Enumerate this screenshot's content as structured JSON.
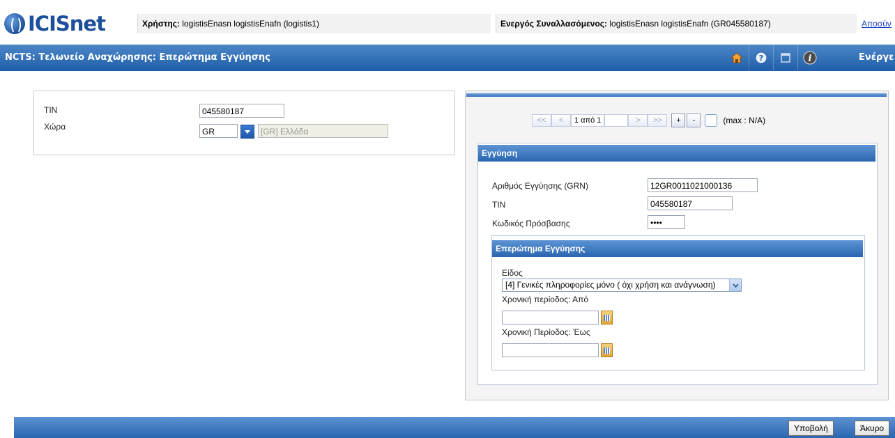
{
  "header": {
    "logo_text": "ICISnet",
    "user_label": "Χρήστης:",
    "user_value": "logistisEnasn logistisEnafn (logistis1)",
    "active_trader_label": "Ενεργός Συναλλασόμενος:",
    "active_trader_value": "logistisEnasn logistisEnafn (GR045580187)",
    "logout_link": "Αποσύν"
  },
  "titlebar": {
    "title": "NCTS: Τελωνείο Αναχώρησης: Επερώτημα Εγγύησης",
    "icons": [
      "home-icon",
      "help-icon",
      "window-icon",
      "info-icon"
    ],
    "active_label": "Ενέργε"
  },
  "left_form": {
    "tin_label": "TIN",
    "tin_value": "045580187",
    "country_label": "Χώρα",
    "country_code": "GR",
    "country_name": "[GR] Ελλάδα"
  },
  "pager": {
    "first": "<<",
    "prev": "<",
    "count": "1 από 1",
    "next": ">",
    "last": ">>",
    "add": "+",
    "remove": "-",
    "max": "(max : N/A)"
  },
  "guarantee": {
    "header": "Εγγύηση",
    "grn_label": "Αριθμός Εγγύησης (GRN)",
    "grn_value": "12GR0011021000136",
    "tin_label": "TIN",
    "tin_value": "045580187",
    "access_code_label": "Κωδικός Πρόσβασης",
    "access_code_value": "••••",
    "query": {
      "header": "Επερώτημα Εγγύησης",
      "type_label": "Είδος",
      "type_value": "[4] Γενικές πληροφορίες μόνο ( όχι χρήση και ανάγνωση)",
      "from_label": "Χρονική περίοδος: Από",
      "from_value": "",
      "to_label": "Χρονική Περίοδος: Έως",
      "to_value": ""
    }
  },
  "footer": {
    "submit": "Υποβολή",
    "cancel": "Άκυρο"
  },
  "colors": {
    "brand_blue": "#1d4f9c",
    "bar_blue": "#2a65b0",
    "link": "#1a3ec9"
  }
}
